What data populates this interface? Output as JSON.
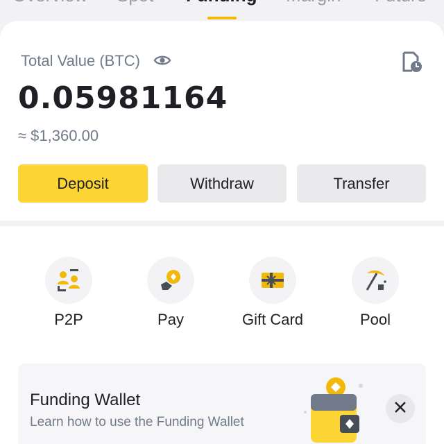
{
  "tabs": [
    {
      "label": "Overview"
    },
    {
      "label": "Spot"
    },
    {
      "label": "Funding",
      "active": true
    },
    {
      "label": "Margin"
    },
    {
      "label": "Future"
    }
  ],
  "balance": {
    "label": "Total Value (BTC)",
    "value": "0.05981164",
    "usd": "≈ $1,360.00"
  },
  "actions": {
    "deposit": "Deposit",
    "withdraw": "Withdraw",
    "transfer": "Transfer"
  },
  "services": [
    {
      "label": "P2P",
      "icon": "p2p-icon"
    },
    {
      "label": "Pay",
      "icon": "pay-icon"
    },
    {
      "label": "Gift Card",
      "icon": "gift-card-icon"
    },
    {
      "label": "Pool",
      "icon": "pool-icon"
    }
  ],
  "promo": {
    "title": "Funding Wallet",
    "subtitle": "Learn how to use the Funding Wallet"
  },
  "colors": {
    "accent": "#fcd535",
    "brand": "#f0b90b",
    "text_primary": "#1e2026",
    "text_secondary": "#707a8a"
  }
}
